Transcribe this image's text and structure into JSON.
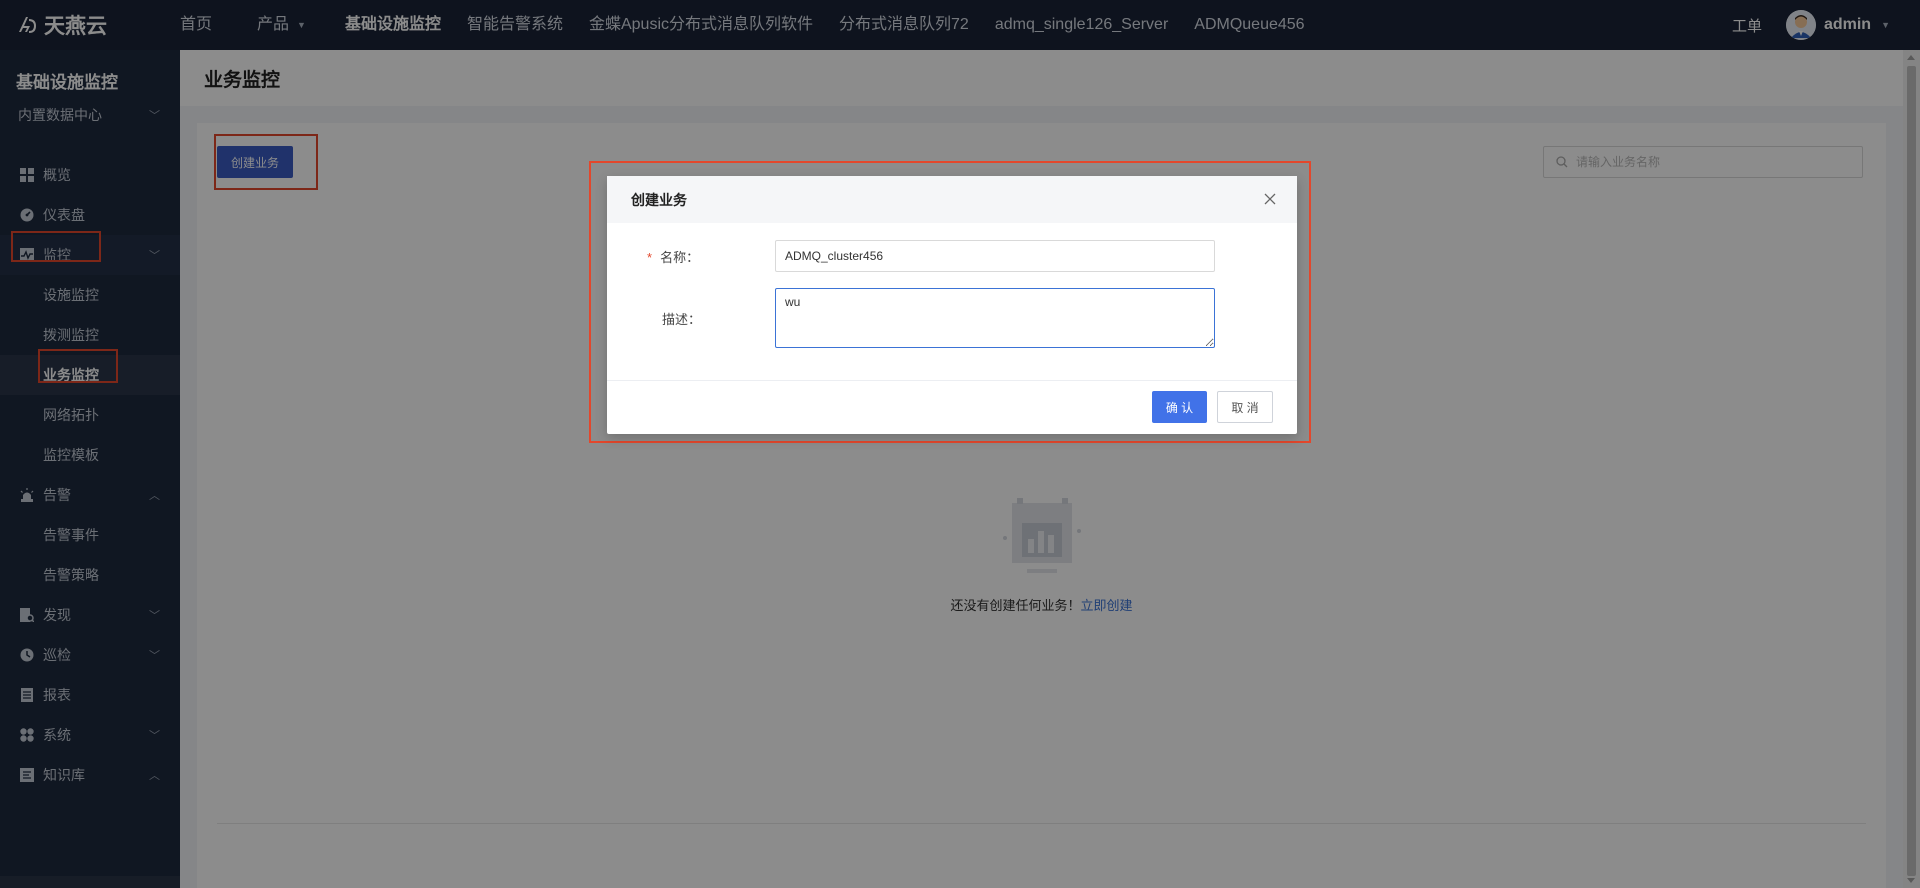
{
  "brand": {
    "name": "天燕云"
  },
  "topnav": {
    "items": [
      {
        "label": "首页"
      },
      {
        "label": "产品"
      },
      {
        "label": "基础设施监控"
      },
      {
        "label": "智能告警系统"
      },
      {
        "label": "金蝶Apusic分布式消息队列软件"
      },
      {
        "label": "分布式消息队列72"
      },
      {
        "label": "admq_single126_Server"
      },
      {
        "label": "ADMQueue456"
      }
    ],
    "work_order": "工单",
    "username": "admin"
  },
  "sidebar": {
    "title": "基础设施监控",
    "datacenter": "内置数据中心",
    "items": [
      {
        "label": "概览",
        "icon": "dashboard-grid-icon"
      },
      {
        "label": "仪表盘",
        "icon": "gauge-icon"
      },
      {
        "label": "监控",
        "icon": "monitor-icon",
        "expanded": true
      },
      {
        "label": "告警",
        "icon": "alarm-icon",
        "expanded": true
      },
      {
        "label": "发现",
        "icon": "discover-icon"
      },
      {
        "label": "巡检",
        "icon": "inspect-icon"
      },
      {
        "label": "报表",
        "icon": "report-icon"
      },
      {
        "label": "系统",
        "icon": "system-icon"
      },
      {
        "label": "知识库",
        "icon": "knowledge-icon",
        "expanded": true
      }
    ],
    "monitor_children": [
      "设施监控",
      "拨测监控",
      "业务监控",
      "网络拓扑",
      "监控模板"
    ],
    "alarm_children": [
      "告警事件",
      "告警策略"
    ],
    "active": "业务监控"
  },
  "page": {
    "title": "业务监控",
    "create_button": "创建业务",
    "search_placeholder": "请输入业务名称",
    "empty_text": "还没有创建任何业务！",
    "empty_link": "立即创建"
  },
  "modal": {
    "title": "创建业务",
    "name_label": "名称：",
    "name_value": "ADMQ_cluster456",
    "desc_label": "描述：",
    "desc_value": "wu",
    "ok_button": "确 认",
    "cancel_button": "取 消"
  },
  "colors": {
    "topbar": "#1b2437",
    "sidebar": "#1e2a3e",
    "primary": "#4172e8",
    "highlight_box": "#e3472c"
  }
}
